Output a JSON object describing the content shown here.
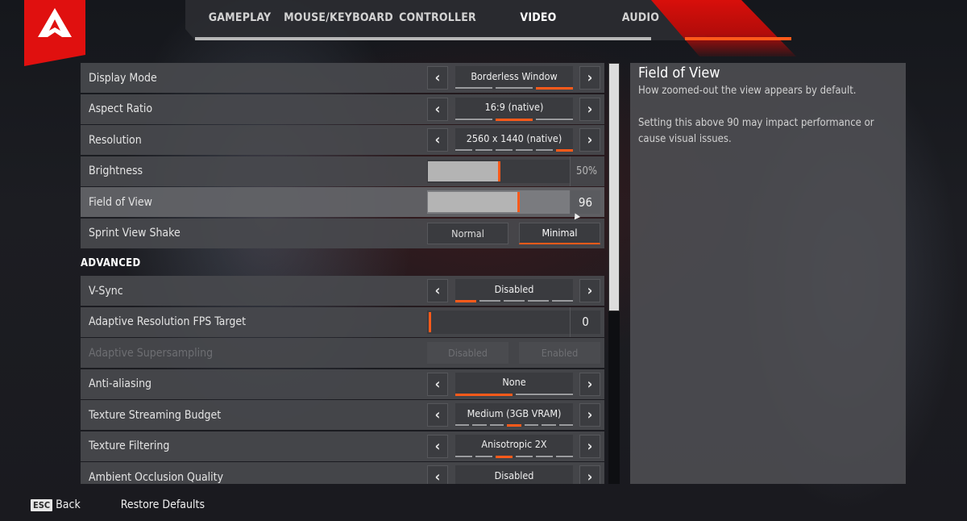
{
  "logo": {
    "name": "apex-legends-logo"
  },
  "tabs": [
    {
      "label": "GAMEPLAY",
      "active": false
    },
    {
      "label": "MOUSE/KEYBOARD",
      "active": false
    },
    {
      "label": "CONTROLLER",
      "active": false
    },
    {
      "label": "VIDEO",
      "active": true
    },
    {
      "label": "AUDIO",
      "active": false
    }
  ],
  "settings": {
    "basic": [
      {
        "label": "Display Mode",
        "type": "cycler",
        "value": "Borderless Window",
        "options_count": 3,
        "selected_index": 2
      },
      {
        "label": "Aspect Ratio",
        "type": "cycler",
        "value": "16:9 (native)",
        "options_count": 3,
        "selected_index": 1
      },
      {
        "label": "Resolution",
        "type": "cycler",
        "value": "2560 x 1440 (native)",
        "options_count": 6,
        "selected_index": 5
      },
      {
        "label": "Brightness",
        "type": "slider",
        "value": "50%",
        "fraction": 0.5
      },
      {
        "label": "Field of View",
        "type": "slider",
        "value": "96",
        "fraction": 0.64,
        "highlighted": true
      },
      {
        "label": "Sprint View Shake",
        "type": "toggle",
        "options": [
          "Normal",
          "Minimal"
        ],
        "selected_index": 1
      }
    ],
    "advanced_header": "ADVANCED",
    "advanced": [
      {
        "label": "V-Sync",
        "type": "cycler",
        "value": "Disabled",
        "options_count": 5,
        "selected_index": 0
      },
      {
        "label": "Adaptive Resolution FPS Target",
        "type": "slider",
        "value": "0",
        "fraction": 0
      },
      {
        "label": "Adaptive Supersampling",
        "type": "toggle",
        "options": [
          "Disabled",
          "Enabled"
        ],
        "selected_index": -1,
        "disabled": true
      },
      {
        "label": "Anti-aliasing",
        "type": "cycler",
        "value": "None",
        "options_count": 2,
        "selected_index": 0
      },
      {
        "label": "Texture Streaming Budget",
        "type": "cycler",
        "value": "Medium (3GB VRAM)",
        "options_count": 7,
        "selected_index": 3
      },
      {
        "label": "Texture Filtering",
        "type": "cycler",
        "value": "Anisotropic 2X",
        "options_count": 6,
        "selected_index": 2
      },
      {
        "label": "Ambient Occlusion Quality",
        "type": "cycler",
        "value": "Disabled",
        "options_count": 0,
        "selected_index": -1
      }
    ]
  },
  "info_panel": {
    "title": "Field of View",
    "lines": [
      "How zoomed-out the view appears by default.",
      "Setting this above 90 may impact performance or cause visual issues."
    ]
  },
  "footer": {
    "esc_key": "ESC",
    "back_label": "Back",
    "restore_label": "Restore Defaults"
  },
  "colors": {
    "accent": "#ff5a1a",
    "brand_red": "#e0100f"
  }
}
